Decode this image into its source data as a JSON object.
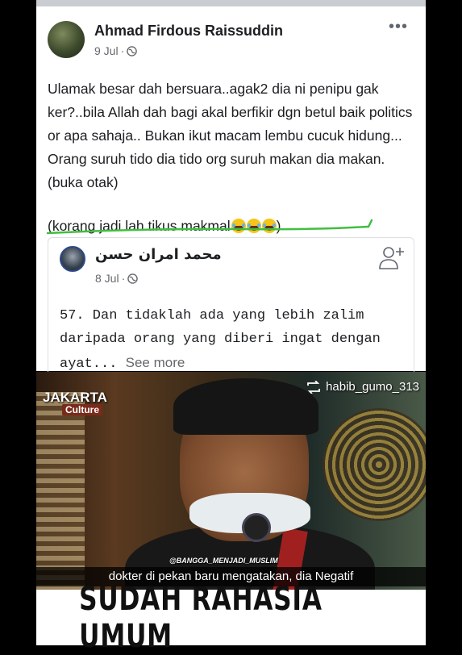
{
  "post": {
    "author": "Ahmad Firdous Raissuddin",
    "date": "9 Jul",
    "separator": "·",
    "more_icon": "more-horizontal-icon",
    "privacy_icon": "globe-icon",
    "text_paragraph_1": "Ulamak besar dah bersuara..agak2 dia ni penipu gak ker?..bila Allah dah bagi akal berfikir  dgn betul baik politics or apa sahaja.. Bukan ikut macam lembu cucuk hidung... Orang suruh tido dia tido org suruh makan dia makan. (buka otak)",
    "text_paragraph_2_before": "(korang jadi lah tikus makmal",
    "text_paragraph_2_after": ")",
    "emoji_icon": "face-with-tears-of-joy-icon",
    "underline_color": "#3fbf3f"
  },
  "shared": {
    "author": "محمد امران حسن",
    "date": "8 Jul",
    "separator": "·",
    "text": "57. Dan tidaklah ada yang lebih zalim daripada orang yang diberi ingat dengan ayat...",
    "see_more": "See more",
    "add_friend_icon": "add-friend-icon"
  },
  "video": {
    "channel_logo": "JAKARTA",
    "channel_sub": "Culture",
    "handle": "habib_gumo_313",
    "repost_icon": "repost-icon",
    "watermark": "@BANGGA_MENJADI_MUSLIM",
    "subtitle": "dokter di pekan baru mengatakan, dia Negatif"
  },
  "banner": {
    "text": "SUDAH RAHASIA UMUM"
  },
  "colors": {
    "card_bg": "#ffffff",
    "page_bg": "#000000",
    "meta_gray": "#65676b",
    "text_dark": "#1c1e21"
  }
}
